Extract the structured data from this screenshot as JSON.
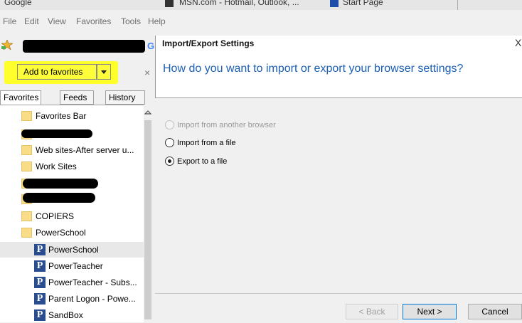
{
  "tabs": [
    {
      "label": "Google"
    },
    {
      "label": "MSN.com - Hotmail, Outlook, ..."
    },
    {
      "label": "Start Page"
    }
  ],
  "menu": [
    "File",
    "Edit",
    "View",
    "Favorites",
    "Tools",
    "Help"
  ],
  "favorites_panel": {
    "add_button": "Add to favorites",
    "close_glyph": "×",
    "tabs": [
      "Favorites",
      "Feeds",
      "History"
    ],
    "items": [
      {
        "type": "folder",
        "label": "Favorites Bar"
      },
      {
        "type": "redacted",
        "label": ""
      },
      {
        "type": "folder",
        "label": "Web sites-After server u..."
      },
      {
        "type": "folder",
        "label": "Work Sites"
      },
      {
        "type": "redacted",
        "label": ""
      },
      {
        "type": "redacted",
        "label": ""
      },
      {
        "type": "folder",
        "label": "COPIERS"
      },
      {
        "type": "folder",
        "label": "PowerSchool"
      },
      {
        "type": "link",
        "label": "PowerSchool",
        "selected": true
      },
      {
        "type": "link",
        "label": "PowerTeacher"
      },
      {
        "type": "link",
        "label": "PowerTeacher - Subs..."
      },
      {
        "type": "link",
        "label": "Parent Logon - Powe..."
      },
      {
        "type": "link",
        "label": "SandBox"
      }
    ]
  },
  "dialog": {
    "title": "Import/Export Settings",
    "close_glyph": "X",
    "question": "How do you want to import or export your browser settings?",
    "options": [
      {
        "label": "Import from another browser",
        "enabled": false,
        "checked": false
      },
      {
        "label": "Import from a file",
        "enabled": true,
        "checked": false
      },
      {
        "label": "Export to a file",
        "enabled": true,
        "checked": true
      }
    ],
    "buttons": {
      "back": "< Back",
      "next": "Next >",
      "cancel": "Cancel"
    }
  },
  "colors": {
    "highlight": "#ffff2b",
    "question_blue": "#1a5fb4",
    "powerschool_blue": "#2a4d8f"
  }
}
